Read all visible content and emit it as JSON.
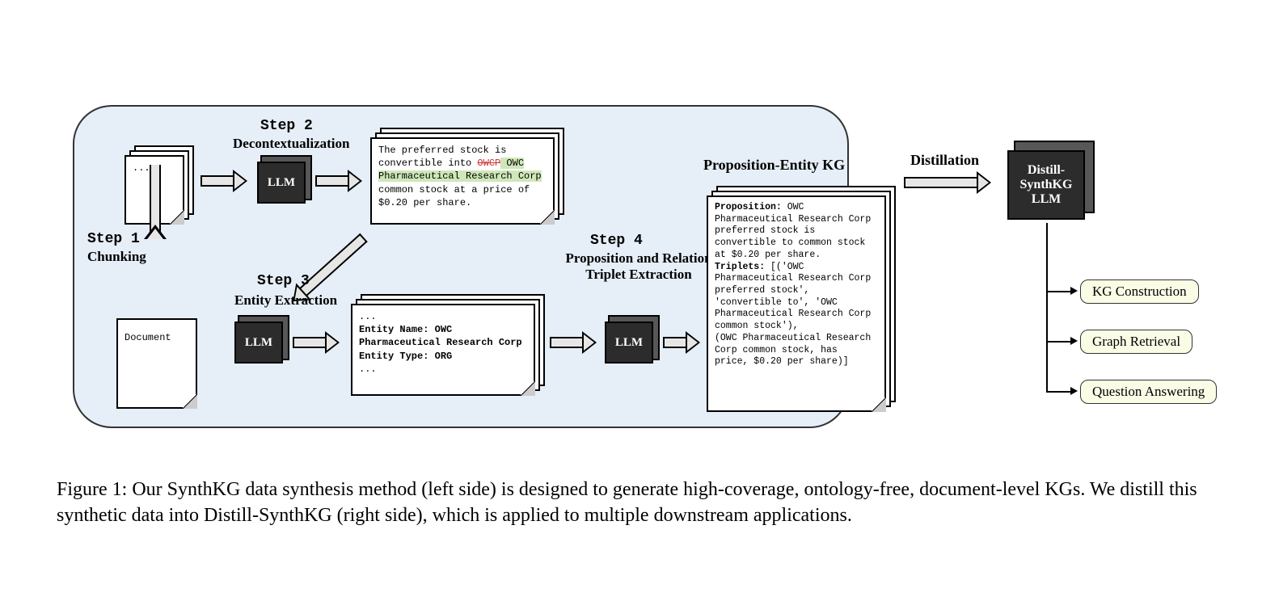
{
  "steps": {
    "s1": {
      "label": "Step 1",
      "sub": "Chunking"
    },
    "s2": {
      "label": "Step 2",
      "sub": "Decontextualization"
    },
    "s3": {
      "label": "Step 3",
      "sub": "Entity Extraction"
    },
    "s4": {
      "label": "Step 4",
      "sub": "Proposition and Relation\nTriplet Extraction"
    }
  },
  "docs": {
    "input_chunk": "...",
    "input_document": "Document",
    "decon": {
      "line1": "The preferred stock is",
      "line2_a": "convertible into ",
      "line2_strike": "OWCP",
      "line2_b": " OWC",
      "line3_hl": "Pharmaceutical Research Corp",
      "line4": "common stock at a price of",
      "line5": "$0.20 per share."
    },
    "entity": {
      "pre": "...",
      "l1": "Entity Name: OWC",
      "l2": "Pharmaceutical Research Corp",
      "l3": "Entity Type: ORG",
      "post": "..."
    },
    "kg": {
      "title": "Proposition-Entity KG",
      "p_label": "Proposition:",
      "p_text": " OWC\nPharmaceutical Research Corp\npreferred stock is\nconvertible to common stock\nat $0.20 per share.",
      "t_label": "Triplets:",
      "t_text": " [('OWC\nPharmaceutical Research Corp\npreferred stock',\n'convertible to', 'OWC\nPharmaceutical Research Corp\ncommon stock'),\n(OWC Pharmaceutical Research\nCorp common stock, has\nprice, $0.20 per share)]"
    }
  },
  "llm_label": "LLM",
  "distill": {
    "label": "Distillation",
    "cube": "Distill-\nSynthKG\nLLM"
  },
  "downstream": {
    "a": "KG Construction",
    "b": "Graph Retrieval",
    "c": "Question Answering"
  },
  "caption": "Figure 1: Our SynthKG data synthesis method (left side) is designed to generate high-coverage, ontology-free, document-level KGs. We distill this synthetic data into Distill-SynthKG (right side), which is applied to multiple downstream applications."
}
